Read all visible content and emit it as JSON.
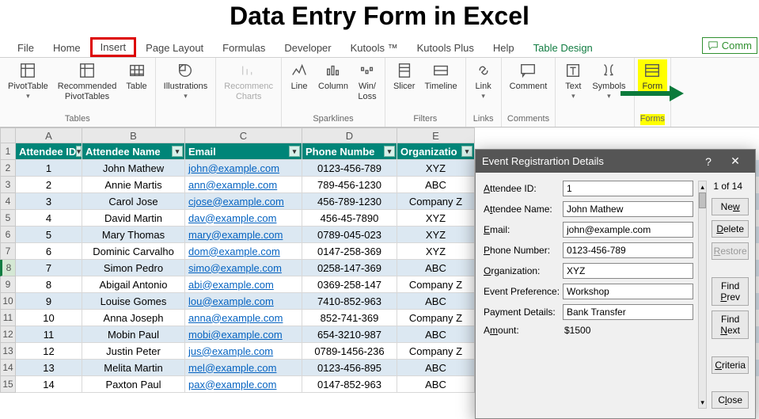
{
  "page_title": "Data Entry Form in Excel",
  "tabs": [
    "File",
    "Home",
    "Insert",
    "Page Layout",
    "Formulas",
    "Developer",
    "Kutools ™",
    "Kutools Plus",
    "Help",
    "Table Design"
  ],
  "comments_label": "Comm",
  "ribbon": {
    "pivottable": "PivotTable",
    "recommended_pivot": "Recommended\nPivotTables",
    "table": "Table",
    "illustrations": "Illustrations",
    "rec_charts": "Recommenc\nCharts",
    "line": "Line",
    "column": "Column",
    "winloss": "Win/\nLoss",
    "slicer": "Slicer",
    "timeline": "Timeline",
    "link": "Link",
    "comment": "Comment",
    "text": "Text",
    "symbols": "Symbols",
    "form": "Form",
    "groups": {
      "tables": "Tables",
      "sparklines": "Sparklines",
      "filters": "Filters",
      "links": "Links",
      "comments": "Comments",
      "forms": "Forms"
    }
  },
  "col_letters": [
    "A",
    "B",
    "C",
    "D",
    "E"
  ],
  "headers": [
    "Attendee ID",
    "Attendee Name",
    "Email",
    "Phone Numbe",
    "Organizatio"
  ],
  "rows": [
    {
      "n": 1,
      "id": "1",
      "name": "John Mathew",
      "email": "john@example.com",
      "phone": "0123-456-789",
      "org": "XYZ"
    },
    {
      "n": 2,
      "id": "2",
      "name": "Annie Martis",
      "email": "ann@example.com",
      "phone": "789-456-1230",
      "org": "ABC"
    },
    {
      "n": 3,
      "id": "3",
      "name": "Carol Jose",
      "email": "cjose@example.com",
      "phone": "456-789-1230",
      "org": "Company Z"
    },
    {
      "n": 4,
      "id": "4",
      "name": "David Martin",
      "email": "dav@example.com",
      "phone": "456-45-7890",
      "org": "XYZ"
    },
    {
      "n": 5,
      "id": "5",
      "name": "Mary Thomas",
      "email": "mary@example.com",
      "phone": "0789-045-023",
      "org": "XYZ"
    },
    {
      "n": 6,
      "id": "6",
      "name": "Dominic Carvalho",
      "email": "dom@example.com",
      "phone": "0147-258-369",
      "org": "XYZ"
    },
    {
      "n": 7,
      "id": "7",
      "name": "Simon Pedro",
      "email": "simo@example.com",
      "phone": "0258-147-369",
      "org": "ABC"
    },
    {
      "n": 8,
      "id": "8",
      "name": "Abigail Antonio",
      "email": "abi@example.com",
      "phone": "0369-258-147",
      "org": "Company Z"
    },
    {
      "n": 9,
      "id": "9",
      "name": "Louise Gomes",
      "email": "lou@example.com",
      "phone": "7410-852-963",
      "org": "ABC"
    },
    {
      "n": 10,
      "id": "10",
      "name": "Anna Joseph",
      "email": "anna@example.com",
      "phone": "852-741-369",
      "org": "Company Z"
    },
    {
      "n": 11,
      "id": "11",
      "name": "Mobin Paul",
      "email": "mobi@example.com",
      "phone": "654-3210-987",
      "org": "ABC"
    },
    {
      "n": 12,
      "id": "12",
      "name": "Justin Peter",
      "email": "jus@example.com",
      "phone": "0789-1456-236",
      "org": "Company Z"
    },
    {
      "n": 13,
      "id": "13",
      "name": "Melita Martin",
      "email": "mel@example.com",
      "phone": "0123-456-895",
      "org": "ABC"
    },
    {
      "n": 14,
      "id": "14",
      "name": "Paxton Paul",
      "email": "pax@example.com",
      "phone": "0147-852-963",
      "org": "ABC"
    }
  ],
  "dialog": {
    "title": "Event Registrartion Details",
    "fields": {
      "attendee_id": {
        "label": "Attendee ID:",
        "value": "1",
        "u": "A"
      },
      "attendee_name": {
        "label": "Attendee Name:",
        "value": "John Mathew",
        "u": "t"
      },
      "email": {
        "label": "Email:",
        "value": "john@example.com",
        "u": "E"
      },
      "phone": {
        "label": "Phone Number:",
        "value": "0123-456-789",
        "u": "P"
      },
      "org": {
        "label": "Organization:",
        "value": "XYZ",
        "u": "O"
      },
      "pref": {
        "label": "Event Preference:",
        "value": "Workshop"
      },
      "payment": {
        "label": "Payment Details:",
        "value": "Bank Transfer"
      },
      "amount": {
        "label": "Amount:",
        "value": "$1500",
        "u": "m"
      }
    },
    "counter": "1 of 14",
    "buttons": {
      "new": "New",
      "delete": "Delete",
      "restore": "Restore",
      "findprev": "Find Prev",
      "findnext": "Find Next",
      "criteria": "Criteria",
      "close": "Close"
    }
  }
}
